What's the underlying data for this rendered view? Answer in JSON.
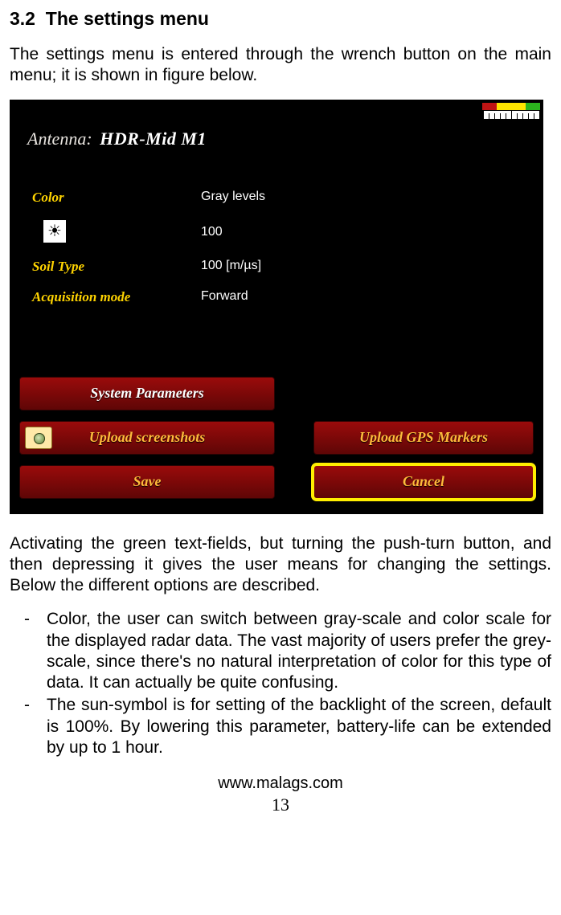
{
  "section": {
    "number": "3.2",
    "title": "The settings menu"
  },
  "intro": "The settings menu is entered through the wrench button on the main menu; it is shown in figure below.",
  "screenshot": {
    "signal_colors": [
      "#c01414",
      "#ffe600",
      "#ffe600",
      "#2bb51e"
    ],
    "antenna": {
      "label": "Antenna:",
      "model": "HDR-Mid M1"
    },
    "rows": [
      {
        "label": "Color",
        "value": "Gray levels"
      },
      {
        "label": "",
        "value": "100",
        "icon": "brightness"
      },
      {
        "label": "Soil Type",
        "value": "100 [m/µs]"
      },
      {
        "label": "Acquisition mode",
        "value": "Forward"
      }
    ],
    "buttons": {
      "system": "System Parameters",
      "upload": "Upload screenshots",
      "gps": "Upload GPS Markers",
      "save": "Save",
      "cancel": "Cancel"
    }
  },
  "after_text": "Activating the green text-fields, but turning the push-turn button, and then depressing it gives the user means for changing the settings. Below the different options are described.",
  "bullets": [
    "Color, the user can switch between gray-scale and color scale for the displayed radar data. The vast majority of users prefer the grey-scale, since there's no natural interpretation of color for this type of data. It can actually be quite confusing.",
    "The sun-symbol is for setting of the backlight of the screen, default is 100%. By lowering this parameter, battery-life can be extended by up to 1 hour."
  ],
  "footer": {
    "url": "www.malags.com",
    "page": "13"
  }
}
